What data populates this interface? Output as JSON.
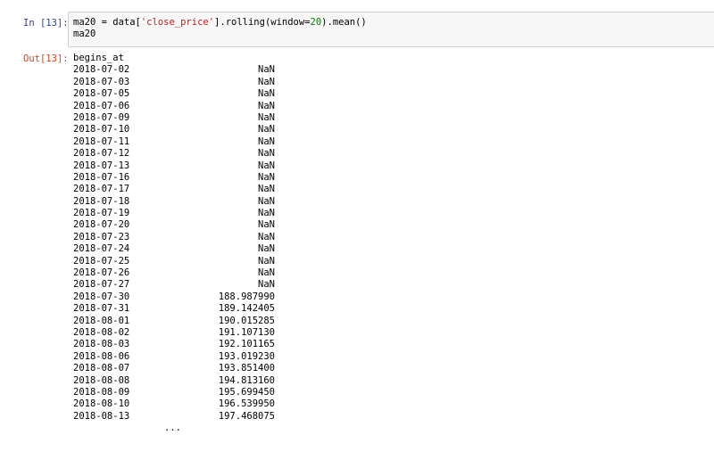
{
  "input_cell": {
    "prompt": "In [13]:",
    "code_line1": {
      "pre": "ma20 = data[",
      "str": "'close_price'",
      "mid": "].rolling(window=",
      "num": "20",
      "post": ").mean()"
    },
    "code_line2": "ma20"
  },
  "output_cell": {
    "prompt": "Out[13]:",
    "index_name": "begins_at",
    "rows": [
      {
        "date": "2018-07-02",
        "value": "NaN"
      },
      {
        "date": "2018-07-03",
        "value": "NaN"
      },
      {
        "date": "2018-07-05",
        "value": "NaN"
      },
      {
        "date": "2018-07-06",
        "value": "NaN"
      },
      {
        "date": "2018-07-09",
        "value": "NaN"
      },
      {
        "date": "2018-07-10",
        "value": "NaN"
      },
      {
        "date": "2018-07-11",
        "value": "NaN"
      },
      {
        "date": "2018-07-12",
        "value": "NaN"
      },
      {
        "date": "2018-07-13",
        "value": "NaN"
      },
      {
        "date": "2018-07-16",
        "value": "NaN"
      },
      {
        "date": "2018-07-17",
        "value": "NaN"
      },
      {
        "date": "2018-07-18",
        "value": "NaN"
      },
      {
        "date": "2018-07-19",
        "value": "NaN"
      },
      {
        "date": "2018-07-20",
        "value": "NaN"
      },
      {
        "date": "2018-07-23",
        "value": "NaN"
      },
      {
        "date": "2018-07-24",
        "value": "NaN"
      },
      {
        "date": "2018-07-25",
        "value": "NaN"
      },
      {
        "date": "2018-07-26",
        "value": "NaN"
      },
      {
        "date": "2018-07-27",
        "value": "NaN"
      },
      {
        "date": "2018-07-30",
        "value": "188.987990"
      },
      {
        "date": "2018-07-31",
        "value": "189.142405"
      },
      {
        "date": "2018-08-01",
        "value": "190.015285"
      },
      {
        "date": "2018-08-02",
        "value": "191.107130"
      },
      {
        "date": "2018-08-03",
        "value": "192.101165"
      },
      {
        "date": "2018-08-06",
        "value": "193.019230"
      },
      {
        "date": "2018-08-07",
        "value": "193.851400"
      },
      {
        "date": "2018-08-08",
        "value": "194.813160"
      },
      {
        "date": "2018-08-09",
        "value": "195.699450"
      },
      {
        "date": "2018-08-10",
        "value": "196.539950"
      },
      {
        "date": "2018-08-13",
        "value": "197.468075"
      }
    ],
    "ellipsis": "..."
  },
  "colors": {
    "in_prompt": "#303f9f",
    "out_prompt": "#d84315",
    "string": "#ba2121",
    "number": "#008000",
    "input_bg": "#f7f7f7"
  }
}
